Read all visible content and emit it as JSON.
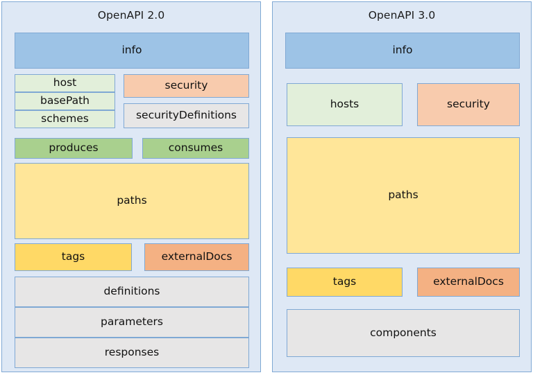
{
  "diagram": {
    "title_left": "OpenAPI 2.0",
    "title_right": "OpenAPI 3.0",
    "colors": {
      "panel_bg": "#DEE8F5",
      "panel_border": "#7FA8D4",
      "info": "#9DC3E6",
      "light_green": "#E2EFDA",
      "green": "#A9D08E",
      "peach": "#F8CBAD",
      "salmon": "#F4B183",
      "gray": "#E7E6E6",
      "light_yellow": "#FFE699",
      "yellow": "#FFD966"
    }
  },
  "panels": [
    {
      "id": "openapi-2",
      "title": "OpenAPI 2.0",
      "nodes": [
        {
          "key": "info",
          "label": "info"
        },
        {
          "key": "host",
          "label": "host"
        },
        {
          "key": "basePath",
          "label": "basePath"
        },
        {
          "key": "schemes",
          "label": "schemes"
        },
        {
          "key": "security",
          "label": "security"
        },
        {
          "key": "securityDefinitions",
          "label": "securityDefinitions"
        },
        {
          "key": "produces",
          "label": "produces"
        },
        {
          "key": "consumes",
          "label": "consumes"
        },
        {
          "key": "paths",
          "label": "paths"
        },
        {
          "key": "tags",
          "label": "tags"
        },
        {
          "key": "externalDocs",
          "label": "externalDocs"
        },
        {
          "key": "definitions",
          "label": "definitions"
        },
        {
          "key": "parameters",
          "label": "parameters"
        },
        {
          "key": "responses",
          "label": "responses"
        }
      ]
    },
    {
      "id": "openapi-3",
      "title": "OpenAPI 3.0",
      "nodes": [
        {
          "key": "info",
          "label": "info"
        },
        {
          "key": "hosts",
          "label": "hosts"
        },
        {
          "key": "security",
          "label": "security"
        },
        {
          "key": "paths",
          "label": "paths"
        },
        {
          "key": "tags",
          "label": "tags"
        },
        {
          "key": "externalDocs",
          "label": "externalDocs"
        },
        {
          "key": "components",
          "label": "components"
        }
      ]
    }
  ]
}
